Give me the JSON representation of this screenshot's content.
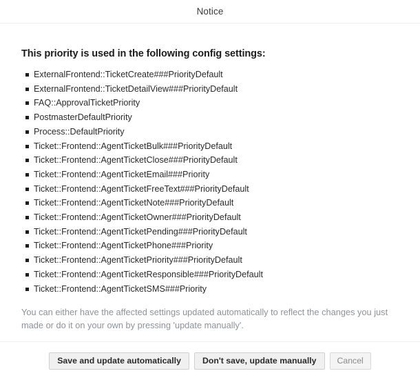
{
  "dialog": {
    "title": "Notice",
    "heading": "This priority is used in the following config settings:",
    "settings": [
      "ExternalFrontend::TicketCreate###PriorityDefault",
      "ExternalFrontend::TicketDetailView###PriorityDefault",
      "FAQ::ApprovalTicketPriority",
      "PostmasterDefaultPriority",
      "Process::DefaultPriority",
      "Ticket::Frontend::AgentTicketBulk###PriorityDefault",
      "Ticket::Frontend::AgentTicketClose###PriorityDefault",
      "Ticket::Frontend::AgentTicketEmail###Priority",
      "Ticket::Frontend::AgentTicketFreeText###PriorityDefault",
      "Ticket::Frontend::AgentTicketNote###PriorityDefault",
      "Ticket::Frontend::AgentTicketOwner###PriorityDefault",
      "Ticket::Frontend::AgentTicketPending###PriorityDefault",
      "Ticket::Frontend::AgentTicketPhone###Priority",
      "Ticket::Frontend::AgentTicketPriority###PriorityDefault",
      "Ticket::Frontend::AgentTicketResponsible###PriorityDefault",
      "Ticket::Frontend::AgentTicketSMS###Priority"
    ],
    "note": "You can either have the affected settings updated automatically to reflect the changes you just made or do it on your own by pressing 'update manually'.",
    "buttons": {
      "save_auto": "Save and update automatically",
      "save_manual": "Don't save, update manually",
      "cancel": "Cancel"
    }
  },
  "colors": {
    "divider": "#eceeef",
    "note_text": "#8e9296",
    "button_face": "#f0f0f0"
  }
}
